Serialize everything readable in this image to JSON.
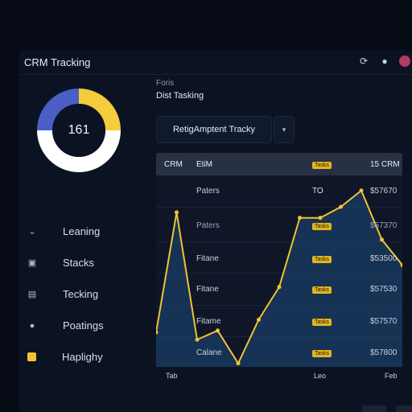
{
  "header": {
    "title": "CRM Tracking",
    "icons": [
      "refresh-icon",
      "user-icon",
      "avatar"
    ]
  },
  "donut": {
    "value": "161",
    "segments": [
      {
        "fraction": 0.25,
        "color": "#f4cc3c"
      },
      {
        "fraction": 0.5,
        "color": "#ffffff"
      },
      {
        "fraction": 0.25,
        "color": "#4a5ec6"
      }
    ]
  },
  "nav": {
    "items": [
      {
        "icon": "chevron-down-icon",
        "label": "Leaning"
      },
      {
        "icon": "box-icon",
        "label": "Stacks"
      },
      {
        "icon": "file-icon",
        "label": "Tecking"
      },
      {
        "icon": "pin-icon",
        "label": "Poatings"
      },
      {
        "icon": "square-icon",
        "label": "Haplighy"
      }
    ]
  },
  "main": {
    "subtitle_small": "Foris",
    "subtitle": "Dist Tasking",
    "search_label": "RetigAmptent Tracky",
    "dropdown_icon": "caret-down-icon"
  },
  "table": {
    "headers": [
      "CRM",
      "EtiM",
      "Tasks",
      "15 CRM"
    ],
    "rows": [
      {
        "name": "Paters",
        "tag": "TO",
        "badge": "",
        "value": "$57670"
      },
      {
        "name": "Paters",
        "tag": "",
        "badge": "Tasks",
        "value": "$57370"
      },
      {
        "name": "Fitane",
        "tag": "",
        "badge": "Tasks",
        "value": "$53500"
      },
      {
        "name": "Fitane",
        "tag": "",
        "badge": "Tasks",
        "value": "$57530"
      },
      {
        "name": "Fitame",
        "tag": "",
        "badge": "Tasks",
        "value": "$57570"
      },
      {
        "name": "Calane",
        "tag": "",
        "badge": "Tasks",
        "value": "$57800"
      }
    ]
  },
  "chart_data": {
    "type": "area",
    "line_color": "#f1c232",
    "fill_color": "#1d4a78",
    "x": [
      "Tab",
      "",
      "",
      "",
      "",
      "",
      "",
      "",
      "",
      "Leo",
      "",
      "",
      "Feb"
    ],
    "values": [
      0.19,
      0.85,
      0.15,
      0.2,
      0.02,
      0.26,
      0.44,
      0.82,
      0.82,
      0.88,
      0.97,
      0.7,
      0.56
    ],
    "x_tick_labels": [
      "Tab",
      "Leo",
      "Feb"
    ]
  }
}
